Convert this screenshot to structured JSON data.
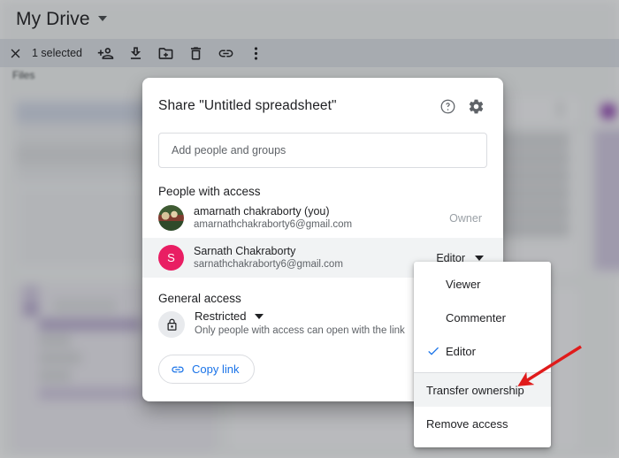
{
  "app": {
    "drive_title": "My Drive",
    "files_label": "Files"
  },
  "selection_bar": {
    "close_icon": "close-icon",
    "count_label": "1 selected",
    "actions": [
      {
        "name": "share-person-add",
        "icon": "person-add-icon"
      },
      {
        "name": "download",
        "icon": "download-icon"
      },
      {
        "name": "move-to-folder",
        "icon": "folder-move-icon"
      },
      {
        "name": "delete",
        "icon": "trash-icon"
      },
      {
        "name": "get-link",
        "icon": "link-icon"
      },
      {
        "name": "more-actions",
        "icon": "more-vert-icon"
      }
    ]
  },
  "dialog": {
    "title": "Share \"Untitled spreadsheet\"",
    "help_icon": "help-circle-icon",
    "settings_icon": "gear-icon",
    "add_people": {
      "placeholder": "Add people and groups",
      "value": ""
    },
    "people_section_title": "People with access",
    "people": [
      {
        "avatar_type": "photo",
        "avatar_letter": "",
        "name": "amarnath chakraborty (you)",
        "email": "amarnathchakraborty6@gmail.com",
        "role": "Owner",
        "role_editable": false
      },
      {
        "avatar_type": "letter",
        "avatar_letter": "S",
        "avatar_color": "#e91e63",
        "name": "Sarnath Chakraborty",
        "email": "sarnathchakraborty6@gmail.com",
        "role": "Editor",
        "role_editable": true
      }
    ],
    "general_access": {
      "section_title": "General access",
      "lock_icon": "lock-icon",
      "value": "Restricted",
      "description": "Only people with access can open with the link"
    },
    "copy_link": {
      "label": "Copy link",
      "icon": "link-icon",
      "color": "#1a73e8"
    }
  },
  "role_menu": {
    "items": [
      {
        "label": "Viewer",
        "checked": false,
        "hovered": false,
        "separator_before": false
      },
      {
        "label": "Commenter",
        "checked": false,
        "hovered": false,
        "separator_before": false
      },
      {
        "label": "Editor",
        "checked": true,
        "hovered": false,
        "separator_before": false
      },
      {
        "label": "Transfer ownership",
        "checked": false,
        "hovered": true,
        "separator_before": true
      },
      {
        "label": "Remove access",
        "checked": false,
        "hovered": false,
        "separator_before": false
      }
    ],
    "check_icon": "check-icon"
  },
  "annotation": {
    "arrow_color": "#e01b1b",
    "points_to": "Transfer ownership"
  }
}
